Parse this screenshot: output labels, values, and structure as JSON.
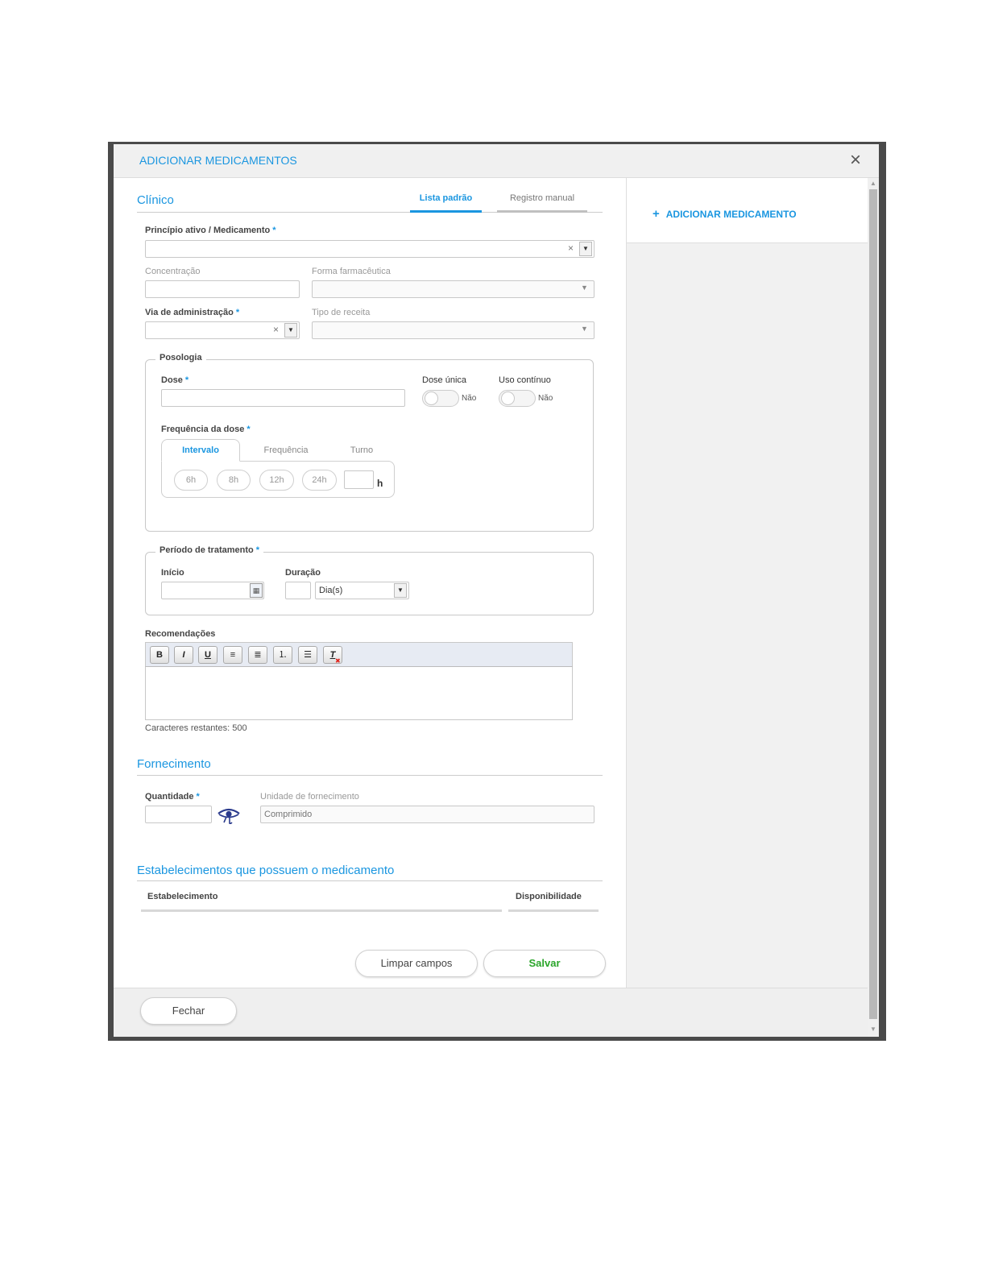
{
  "dialog": {
    "title": "ADICIONAR MEDICAMENTOS",
    "close": "×"
  },
  "clinico": {
    "title": "Clínico",
    "tabs": [
      {
        "label": "Lista padrão",
        "active": true
      },
      {
        "label": "Registro manual",
        "active": false
      }
    ],
    "principio": {
      "label": "Princípio ativo / Medicamento",
      "required": "*",
      "value": ""
    },
    "concentracao": {
      "label": "Concentração",
      "value": ""
    },
    "forma": {
      "label": "Forma farmacêutica",
      "value": ""
    },
    "via": {
      "label": "Via de administração",
      "required": "*",
      "value": ""
    },
    "tipo_receita": {
      "label": "Tipo de receita",
      "value": ""
    }
  },
  "posologia": {
    "legend": "Posologia",
    "dose": {
      "label": "Dose",
      "required": "*",
      "value": ""
    },
    "dose_unica": {
      "label": "Dose única",
      "state": "Não"
    },
    "uso_continuo": {
      "label": "Uso contínuo",
      "state": "Não"
    },
    "frequencia": {
      "label": "Frequência da dose",
      "required": "*",
      "tabs": [
        {
          "label": "Intervalo",
          "active": true
        },
        {
          "label": "Frequência",
          "active": false
        },
        {
          "label": "Turno",
          "active": false
        }
      ],
      "options": [
        "6h",
        "8h",
        "12h",
        "24h"
      ],
      "custom_unit": "h",
      "custom_value": ""
    }
  },
  "periodo": {
    "legend": "Período de tratamento",
    "required": "*",
    "inicio": {
      "label": "Início",
      "value": ""
    },
    "duracao": {
      "label": "Duração",
      "value": "",
      "unit": "Dia(s)"
    }
  },
  "recomendacoes": {
    "label": "Recomendações",
    "toolbar": [
      "B",
      "I",
      "U",
      "align-left",
      "align-center",
      "numbered-list",
      "bullet-list",
      "clear-format"
    ],
    "toolbar_glyphs": {
      "B": "B",
      "I": "I",
      "U": "U",
      "align-left": "≡",
      "align-center": "≣",
      "numbered-list": "⒈",
      "bullet-list": "☰",
      "clear-format": "T"
    },
    "remaining": "Caracteres restantes: 500"
  },
  "fornecimento": {
    "title": "Fornecimento",
    "quantidade": {
      "label": "Quantidade",
      "required": "*",
      "value": ""
    },
    "unidade": {
      "label": "Unidade de fornecimento",
      "placeholder": "Comprimido"
    }
  },
  "estabelecimentos": {
    "title": "Estabelecimentos que possuem o medicamento",
    "columns": [
      "Estabelecimento",
      "Disponibilidade"
    ]
  },
  "actions": {
    "clear": "Limpar campos",
    "save": "Salvar",
    "close": "Fechar"
  },
  "sidebar": {
    "add_label": "ADICIONAR MEDICAMENTO",
    "add_icon": "+"
  },
  "colors": {
    "accent": "#1a96e0",
    "save": "#2aa52a",
    "required": "#1a96e0"
  }
}
